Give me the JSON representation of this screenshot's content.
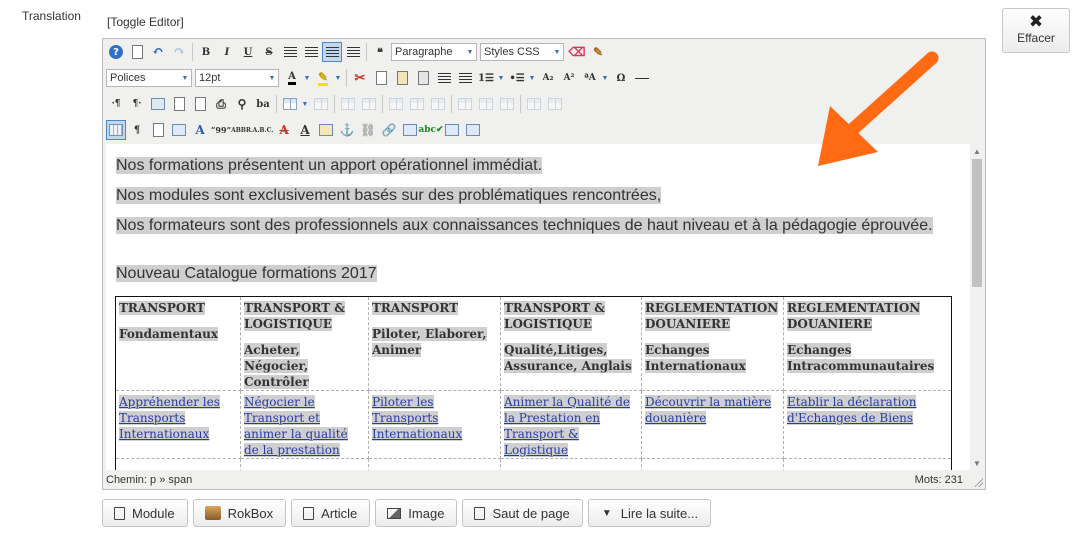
{
  "form": {
    "label": "Translation",
    "toggle_editor": "[Toggle Editor]",
    "clear_label": "Effacer"
  },
  "toolbar": {
    "format_select": "Paragraphe",
    "styles_select": "Styles CSS",
    "font_select": "Polices",
    "size_select": "12pt",
    "icons_row1": [
      "help-icon",
      "new-document-icon",
      "undo-icon",
      "redo-icon",
      "bold-icon",
      "italic-icon",
      "underline-icon",
      "strikethrough-icon",
      "align-left-icon",
      "align-center-icon",
      "align-right-icon",
      "align-justify-icon",
      "blockquote-icon",
      "eraser-icon",
      "format-brush-icon"
    ],
    "labels": {
      "bold": "B",
      "italic": "I",
      "underline": "U",
      "strike": "S",
      "text_color": "A",
      "subscript": "A₂",
      "superscript": "A²",
      "omega": "Ω",
      "dir_ltr": "·¶",
      "dir_rtl": "¶·",
      "pilcrow": "¶",
      "abbr": "ABBR.",
      "acronym": "A.B.C.",
      "cite": "“99”"
    }
  },
  "content": {
    "paragraphs": [
      "Nos formations présentent un apport opérationnel immédiat.",
      "Nos modules sont exclusivement basés sur des problématiques rencontrées,",
      "Nos formateurs sont des professionnels aux connaissances techniques de haut niveau et à la pédagogie éprouvée.",
      "Nouveau Catalogue formations 2017"
    ],
    "table": {
      "header_line1": [
        "TRANSPORT",
        "TRANSPORT & LOGISTIQUE",
        "TRANSPORT",
        "TRANSPORT & LOGISTIQUE",
        "REGLEMENTATION DOUANIERE",
        "REGLEMENTATION DOUANIERE"
      ],
      "header_line2": [
        "Fondamentaux",
        "Acheter, Négocier, Contrôler",
        "Piloter, Elaborer, Animer",
        "Qualité,Litiges, Assurance, Anglais",
        "Echanges Internationaux",
        "Echanges Intracommunautaires"
      ],
      "row1": [
        "Appréhender les Transports Internationaux",
        "Négocier le Transport et animer la qualité de la prestation",
        "Piloter les Transports Internationaux",
        "Animer la Qualité de la Prestation en Transport & Logistique",
        "Découvrir la matière douanière",
        "Etablir la déclaration d'Echanges de Biens"
      ]
    }
  },
  "status": {
    "path_label": "Chemin:",
    "path_value": "p » span",
    "words_label": "Mots:",
    "words_value": "231"
  },
  "buttons": [
    {
      "label": "Module",
      "icon": "insert-module-icon"
    },
    {
      "label": "RokBox",
      "icon": "rokbox-icon"
    },
    {
      "label": "Article",
      "icon": "insert-article-icon"
    },
    {
      "label": "Image",
      "icon": "image-icon"
    },
    {
      "label": "Saut de page",
      "icon": "page-break-icon"
    },
    {
      "label": "Lire la suite...",
      "icon": "chevron-down-icon"
    }
  ],
  "colors": {
    "annotation_arrow": "#ff6a13",
    "highlight": "#cfcfcf",
    "link": "#2a3d9a"
  }
}
